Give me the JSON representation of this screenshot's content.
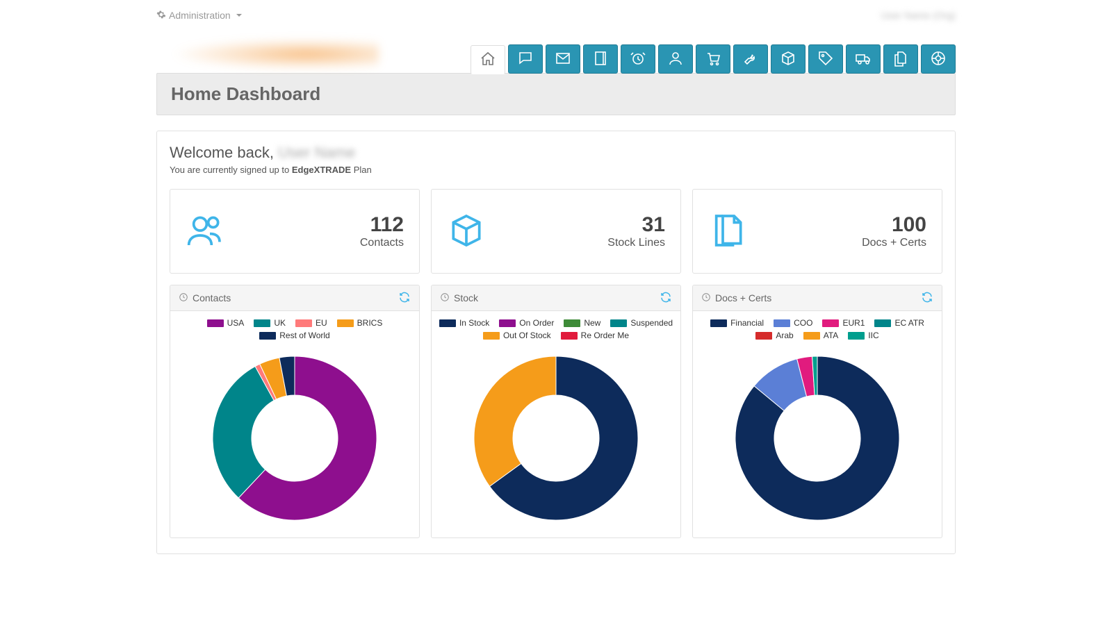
{
  "top": {
    "admin_label": "Administration",
    "user_label": "User Name (Org)"
  },
  "nav": {
    "items": [
      {
        "name": "home-icon"
      },
      {
        "name": "chat-icon"
      },
      {
        "name": "mail-icon"
      },
      {
        "name": "book-icon"
      },
      {
        "name": "alarm-icon"
      },
      {
        "name": "user-icon"
      },
      {
        "name": "cart-icon"
      },
      {
        "name": "wrench-icon"
      },
      {
        "name": "package-icon"
      },
      {
        "name": "tag-icon"
      },
      {
        "name": "truck-icon"
      },
      {
        "name": "files-icon"
      },
      {
        "name": "help-icon"
      }
    ]
  },
  "page_title": "Home Dashboard",
  "welcome": {
    "prefix": "Welcome back, ",
    "name": "User Name",
    "plan_prefix": "You are currently signed up to ",
    "plan_name": "EdgeXTRADE",
    "plan_suffix": " Plan"
  },
  "stats": [
    {
      "icon": "contacts-icon",
      "value": "112",
      "label": "Contacts"
    },
    {
      "icon": "stock-icon",
      "value": "31",
      "label": "Stock Lines"
    },
    {
      "icon": "docs-icon",
      "value": "100",
      "label": "Docs + Certs"
    }
  ],
  "charts": [
    {
      "title": "Contacts"
    },
    {
      "title": "Stock"
    },
    {
      "title": "Docs + Certs"
    }
  ],
  "chart_data": [
    {
      "type": "pie",
      "title": "Contacts",
      "series": [
        {
          "name": "USA",
          "value": 62,
          "color": "#8e0f8e"
        },
        {
          "name": "UK",
          "value": 30,
          "color": "#00858a"
        },
        {
          "name": "EU",
          "value": 1,
          "color": "#ff7a7a"
        },
        {
          "name": "BRICS",
          "value": 4,
          "color": "#f59c1a"
        },
        {
          "name": "Rest of World",
          "value": 3,
          "color": "#0d2b5b"
        }
      ]
    },
    {
      "type": "pie",
      "title": "Stock",
      "series": [
        {
          "name": "In Stock",
          "value": 65,
          "color": "#0d2b5b"
        },
        {
          "name": "On Order",
          "value": 0,
          "color": "#8e0f8e"
        },
        {
          "name": "New",
          "value": 0,
          "color": "#3d8b37"
        },
        {
          "name": "Suspended",
          "value": 0,
          "color": "#00858a"
        },
        {
          "name": "Out Of Stock",
          "value": 35,
          "color": "#f59c1a"
        },
        {
          "name": "Re Order Me",
          "value": 0,
          "color": "#e11b3c"
        }
      ]
    },
    {
      "type": "pie",
      "title": "Docs + Certs",
      "series": [
        {
          "name": "Financial",
          "value": 86,
          "color": "#0d2b5b"
        },
        {
          "name": "COO",
          "value": 10,
          "color": "#5b7fd6"
        },
        {
          "name": "EUR1",
          "value": 3,
          "color": "#e11b7e"
        },
        {
          "name": "EC ATR",
          "value": 0,
          "color": "#00858a"
        },
        {
          "name": "Arab",
          "value": 0,
          "color": "#d52b2b"
        },
        {
          "name": "ATA",
          "value": 0,
          "color": "#f59c1a"
        },
        {
          "name": "IIC",
          "value": 1,
          "color": "#009e8e"
        }
      ]
    }
  ]
}
